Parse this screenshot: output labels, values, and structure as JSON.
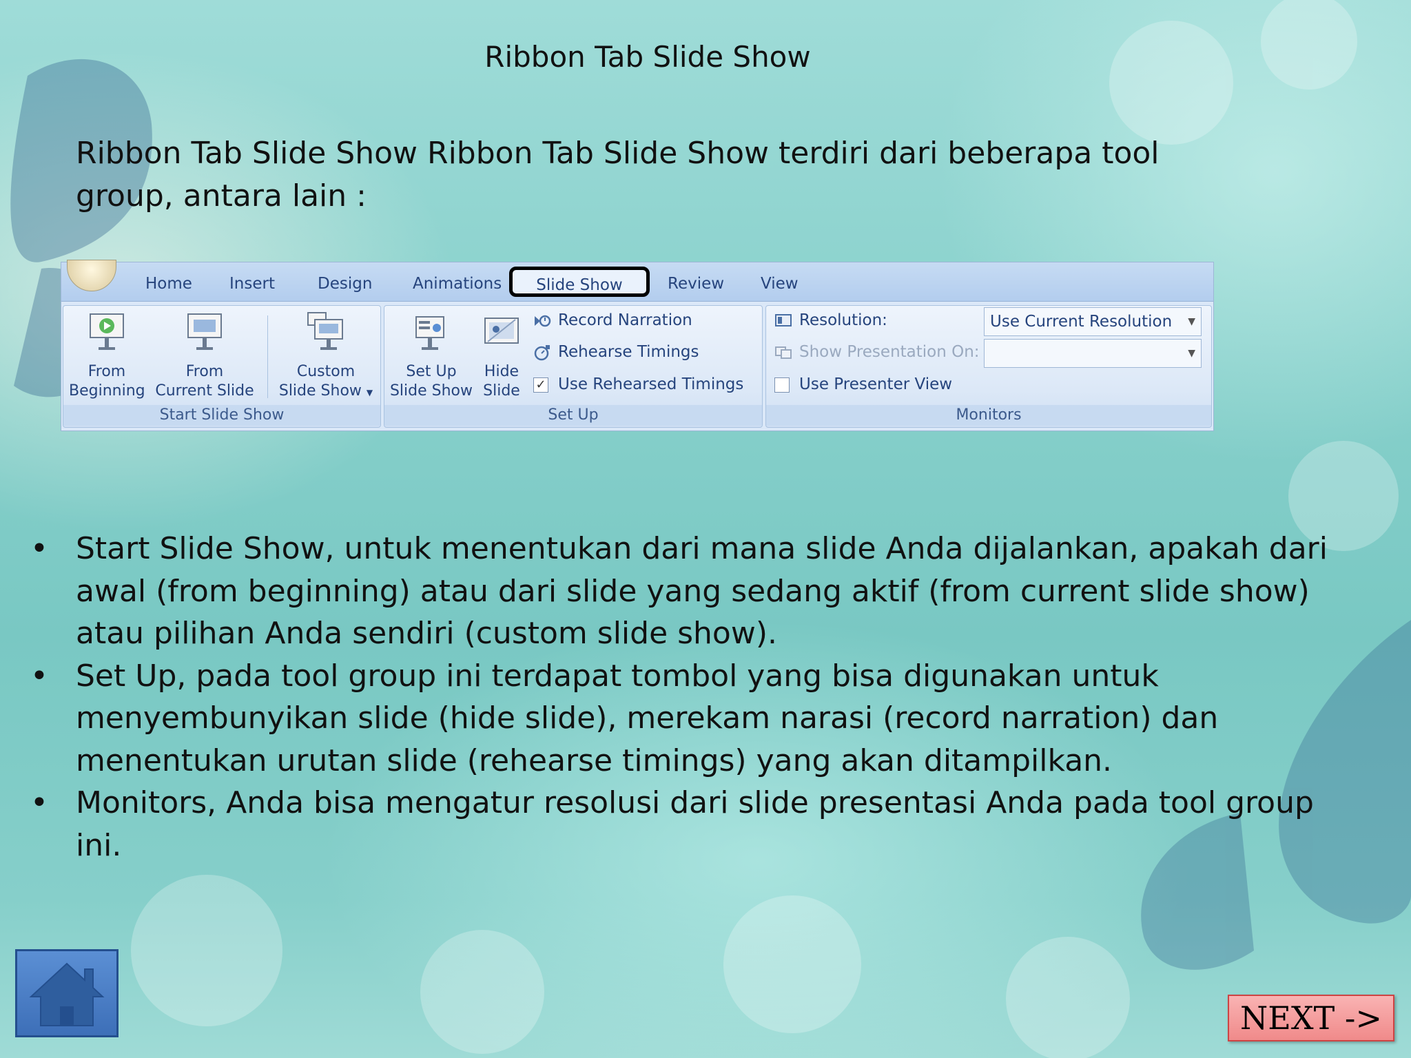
{
  "title": "Ribbon Tab Slide Show",
  "intro": "Ribbon Tab Slide Show Ribbon Tab Slide Show terdiri dari beberapa tool group, antara lain :",
  "ribbon": {
    "tabs": [
      "Home",
      "Insert",
      "Design",
      "Animations",
      "Slide Show",
      "Review",
      "View"
    ],
    "active_tab": "Slide Show",
    "groups": {
      "start": {
        "label": "Start Slide Show",
        "from_beginning": [
          "From",
          "Beginning"
        ],
        "from_current": [
          "From",
          "Current Slide"
        ],
        "custom": [
          "Custom",
          "Slide Show"
        ]
      },
      "setup": {
        "label": "Set Up",
        "set_up": [
          "Set Up",
          "Slide Show"
        ],
        "hide": [
          "Hide",
          "Slide"
        ],
        "record_narration": "Record Narration",
        "rehearse_timings": "Rehearse Timings",
        "use_rehearsed": "Use Rehearsed Timings",
        "use_rehearsed_checked": true
      },
      "monitors": {
        "label": "Monitors",
        "resolution_label": "Resolution:",
        "resolution_value": "Use Current Resolution",
        "show_on_label": "Show Presentation On:",
        "show_on_value": "",
        "presenter_view": "Use Presenter View",
        "presenter_view_checked": false
      }
    }
  },
  "bullets": [
    "Start Slide Show, untuk menentukan dari mana slide Anda dijalankan, apakah dari awal (from beginning) atau dari slide yang sedang aktif (from current slide show) atau pilihan Anda sendiri (custom slide show).",
    "Set Up, pada tool group ini terdapat tombol yang bisa digunakan untuk menyembunyikan slide (hide slide), merekam narasi (record narration) dan menentukan urutan slide (rehearse timings) yang akan ditampilkan.",
    "Monitors, Anda bisa mengatur resolusi dari slide presentasi Anda pada tool group ini."
  ],
  "bullet_symbol": "•",
  "nav": {
    "home_icon": "home-icon",
    "next_label": "NEXT ->"
  }
}
